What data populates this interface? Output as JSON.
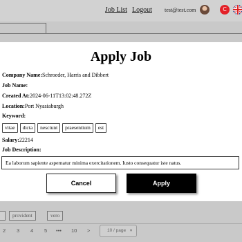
{
  "header": {
    "job_list_link": "Job List",
    "logout_link": "Logout",
    "user_email": "test@test.com",
    "lang_tr": "C"
  },
  "modal": {
    "title": "Apply Job",
    "company_label": "Company Name:",
    "company_value": "Schroeder, Harris and Dibbert",
    "job_name_label": "Job Name:",
    "job_name_value": "",
    "created_label": "Created At:",
    "created_value": "2024-06-11T13:02:48.272Z",
    "location_label": "Location:",
    "location_value": "Port Nyasiaburgh",
    "keyword_label": "Keyword:",
    "keywords": [
      "vitae",
      "dicta",
      "nesciunt",
      "praesentium",
      "est"
    ],
    "salary_label": "Salary:",
    "salary_value": "22214",
    "description_label": "Job Description:",
    "description_value": "Ea laborum sapiente aspernatur minima exercitationem. Iusto consequatur iste natus.",
    "cancel_label": "Cancel",
    "apply_label": "Apply"
  },
  "background": {
    "tags": [
      "provident",
      "vero"
    ]
  },
  "pagination": {
    "pages": [
      "2",
      "3",
      "4",
      "5",
      "•••",
      "10"
    ],
    "next": ">",
    "page_size": "10 / page"
  }
}
